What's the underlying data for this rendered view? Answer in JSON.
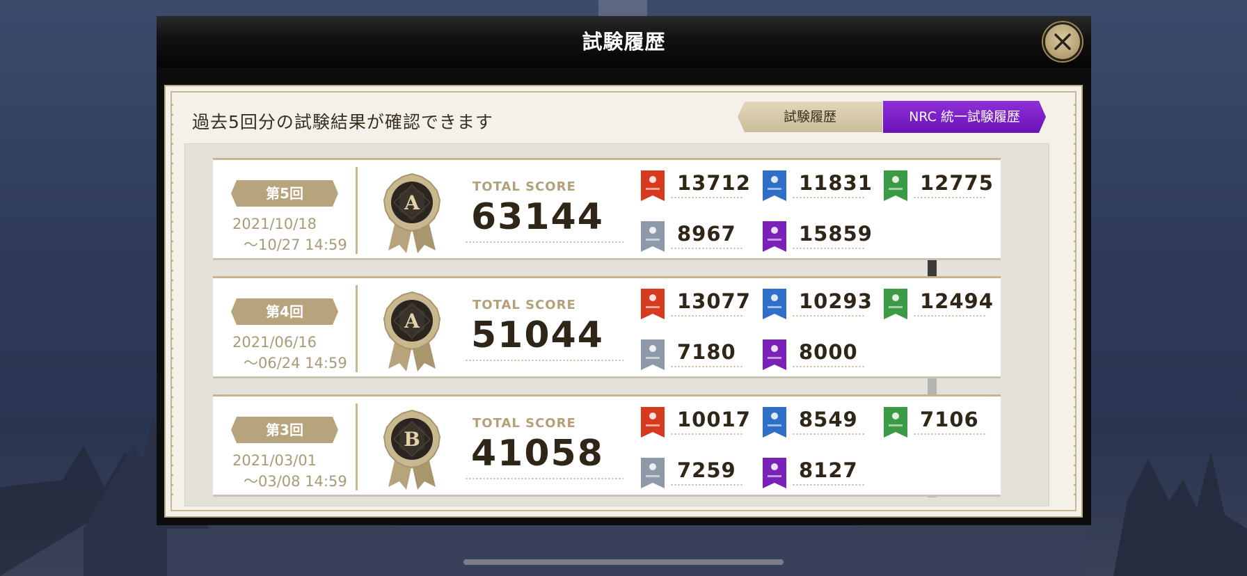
{
  "modal": {
    "title": "試験履歴"
  },
  "panel": {
    "subtitle": "過去5回分の試験結果が確認できます",
    "tabs": [
      {
        "label": "試験履歴",
        "active": false
      },
      {
        "label": "NRC 統一試験履歴",
        "active": true
      }
    ]
  },
  "total_score_label": "TOTAL SCORE",
  "colors": {
    "accent": "#7b1fc8",
    "gold": "#b7a47c",
    "fire": "#d63a1f",
    "water": "#2f6fc7",
    "wood": "#3b9a45",
    "wind": "#8d98a8",
    "mystic": "#7a22b8"
  },
  "records": [
    {
      "round": "第5回",
      "date_start": "2021/10/18",
      "date_end": "〜10/27 14:59",
      "grade": "A",
      "total": "63144",
      "stats": [
        {
          "icon": "fire-test-flag-icon",
          "value": "13712"
        },
        {
          "icon": "water-test-flag-icon",
          "value": "11831"
        },
        {
          "icon": "wood-test-flag-icon",
          "value": "12775"
        },
        {
          "icon": "wind-test-flag-icon",
          "value": "8967"
        },
        {
          "icon": "mystic-test-flag-icon",
          "value": "15859"
        }
      ]
    },
    {
      "round": "第4回",
      "date_start": "2021/06/16",
      "date_end": "〜06/24 14:59",
      "grade": "A",
      "total": "51044",
      "stats": [
        {
          "icon": "fire-test-flag-icon",
          "value": "13077"
        },
        {
          "icon": "water-test-flag-icon",
          "value": "10293"
        },
        {
          "icon": "wood-test-flag-icon",
          "value": "12494"
        },
        {
          "icon": "wind-test-flag-icon",
          "value": "7180"
        },
        {
          "icon": "mystic-test-flag-icon",
          "value": "8000"
        }
      ]
    },
    {
      "round": "第3回",
      "date_start": "2021/03/01",
      "date_end": "〜03/08 14:59",
      "grade": "B",
      "total": "41058",
      "stats": [
        {
          "icon": "fire-test-flag-icon",
          "value": "10017"
        },
        {
          "icon": "water-test-flag-icon",
          "value": "8549"
        },
        {
          "icon": "wood-test-flag-icon",
          "value": "7106"
        },
        {
          "icon": "wind-test-flag-icon",
          "value": "7259"
        },
        {
          "icon": "mystic-test-flag-icon",
          "value": "8127"
        }
      ]
    }
  ]
}
